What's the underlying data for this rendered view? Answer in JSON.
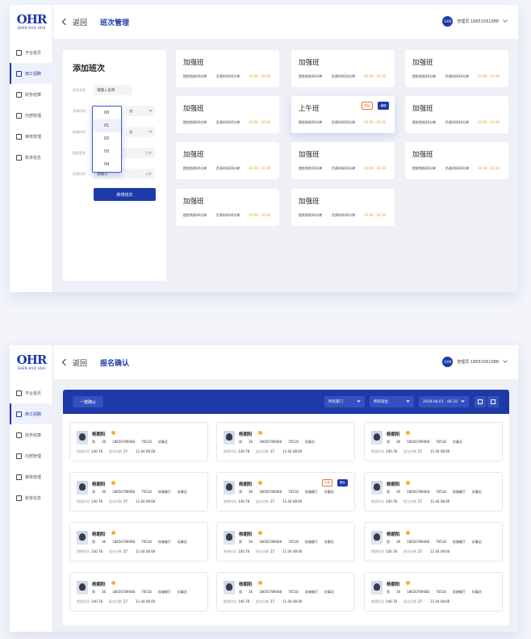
{
  "brand": {
    "logo": "OHR",
    "logo_sub": "SHEN HUO HUA",
    "accent": "#1e3aa8"
  },
  "sidebar": {
    "items": [
      {
        "label": "平台首页",
        "icon": "home-icon"
      },
      {
        "label": "用工招聘",
        "icon": "recruit-icon",
        "active": true
      },
      {
        "label": "财务结算",
        "icon": "finance-icon"
      },
      {
        "label": "内部管理",
        "icon": "grid-icon"
      },
      {
        "label": "审核管理",
        "icon": "audit-icon"
      },
      {
        "label": "账单信息",
        "icon": "bill-icon"
      }
    ]
  },
  "user": {
    "avatar": "OHR",
    "name": "管理员",
    "phone": "18651561988"
  },
  "shift_page": {
    "back": "返回",
    "title": "班次管理",
    "form": {
      "heading": "添加班次",
      "name_label": "班次名称",
      "name_value": "请输入名称",
      "start_label": "开始时间",
      "start_unit": "分",
      "end_label": "结束时间",
      "end_unit": "分",
      "early_label": "提前签到",
      "early_unit": "分钟",
      "late_label": "迟签时间",
      "late_value": "请输入",
      "late_unit": "分钟",
      "submit": "新增班次",
      "dropdown_options": [
        "00",
        "01",
        "02",
        "03",
        "04"
      ]
    },
    "cards": [
      {
        "name": "加强班",
        "early": "提前到岗30分钟",
        "late": "负责时间30分钟",
        "time": "10:00 - 16:30"
      },
      {
        "name": "加强班",
        "early": "提前到岗30分钟",
        "late": "负责时间30分钟",
        "time": "10:00 - 16:30"
      },
      {
        "name": "加强班",
        "early": "提前到岗30分钟",
        "late": "负责时间30分钟",
        "time": "10:00 - 16:30"
      },
      {
        "name": "加强班",
        "early": "提前到岗30分钟",
        "late": "负责时间30分钟",
        "time": "10:00 - 16:30"
      },
      {
        "name": "上午班",
        "early": "提前到岗30分钟",
        "late": "负责时间30分钟",
        "time": "10:00 - 16:30",
        "delete": "删除",
        "edit": "编辑"
      },
      {
        "name": "加强班",
        "early": "提前到岗30分钟",
        "late": "负责时间30分钟",
        "time": "10:00 - 16:30"
      },
      {
        "name": "加强班",
        "early": "提前到岗30分钟",
        "late": "负责时间30分钟",
        "time": "10:00 - 16:30"
      },
      {
        "name": "加强班",
        "early": "提前到岗30分钟",
        "late": "负责时间30分钟",
        "time": "10:00 - 16:30"
      },
      {
        "name": "加强班",
        "early": "提前到岗30分钟",
        "late": "负责时间30分钟",
        "time": "10:00 - 16:30"
      },
      {
        "name": "加强班",
        "early": "提前到岗30分钟",
        "late": "负责时间30分钟",
        "time": "10:00 - 16:30"
      },
      {
        "name": "加强班",
        "early": "提前到岗30分钟",
        "late": "负责时间30分钟",
        "time": "10:00 - 16:30"
      }
    ]
  },
  "signup_page": {
    "back": "返回",
    "title": "报名确认",
    "onekey": "一键确认",
    "dept": "所有部门",
    "post": "所有岗位",
    "date_range": "2019.06.01 - 06.10",
    "person": {
      "name": "杨朝阳",
      "gender": "男",
      "age": "36",
      "phone": "18656789068",
      "height": "76518",
      "position": "炊事员",
      "store": "玫瑰餐厅",
      "wage_label": "期望时间",
      "wage": "140.78",
      "count_label": "报名份数",
      "count": "27",
      "date": "11.04 08:00"
    },
    "reject": "拒绝",
    "confirm": "确认"
  }
}
